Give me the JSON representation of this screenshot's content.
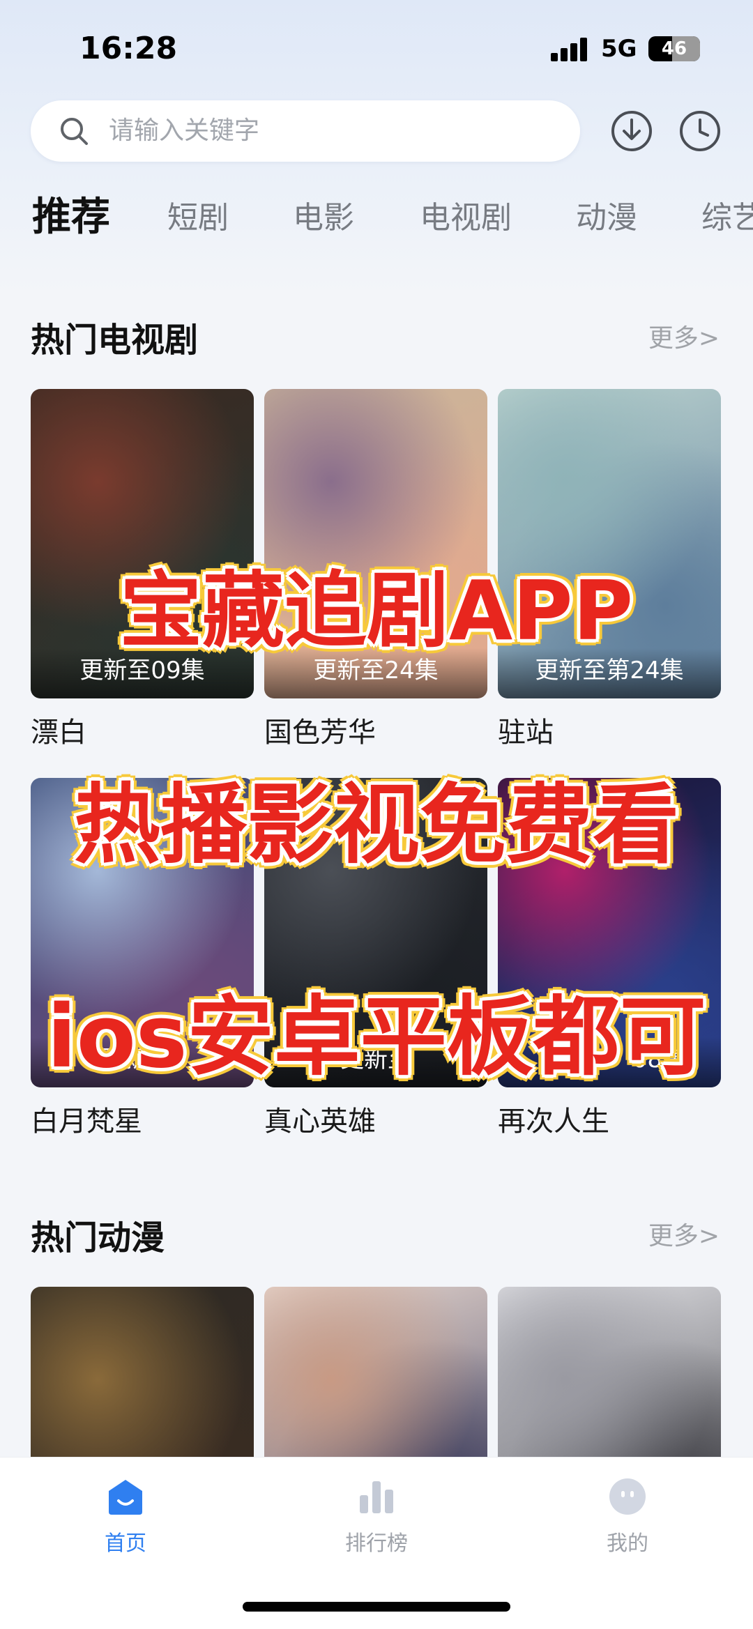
{
  "status_bar": {
    "time": "16:28",
    "network": "5G",
    "battery": "46",
    "battery_level": 0.46
  },
  "search": {
    "placeholder": "请输入关键字",
    "icon": "search-icon"
  },
  "header_icons": [
    "download-icon",
    "history-clock-icon"
  ],
  "tabs": [
    {
      "label": "推荐",
      "active": true
    },
    {
      "label": "短剧"
    },
    {
      "label": "电影"
    },
    {
      "label": "电视剧"
    },
    {
      "label": "动漫"
    },
    {
      "label": "综艺"
    }
  ],
  "sections": {
    "tv": {
      "title": "热门电视剧",
      "more": "更多>",
      "items": [
        {
          "title": "漂白",
          "badge": "更新至09集",
          "colors": [
            "#3a2a22",
            "#7a3b2e",
            "#2a3530"
          ]
        },
        {
          "title": "国色芳华",
          "badge": "更新至24集",
          "colors": [
            "#c9b49a",
            "#8a6e8c",
            "#e2a98e"
          ]
        },
        {
          "title": "驻站",
          "badge": "更新至第24集",
          "colors": [
            "#bcd3cf",
            "#8fb3b8",
            "#5e7e9c"
          ]
        },
        {
          "title": "白月梵星",
          "badge": "更新至2",
          "colors": [
            "#3a4c78",
            "#a4b8d8",
            "#6a4a7a"
          ]
        },
        {
          "title": "真心英雄",
          "badge": "更新至",
          "colors": [
            "#2a2d33",
            "#4b4f56",
            "#1c1f24"
          ]
        },
        {
          "title": "再次人生",
          "badge": "08集",
          "colors": [
            "#1a1436",
            "#b0206a",
            "#2a3f8a"
          ]
        }
      ]
    },
    "anime": {
      "title": "热门动漫",
      "more": "更多>",
      "items": [
        {
          "colors": [
            "#2e2a24",
            "#8a6a3a",
            "#3a2c22"
          ]
        },
        {
          "colors": [
            "#e8d8d0",
            "#c89a84",
            "#3a3a5a"
          ]
        },
        {
          "colors": [
            "#e4e4e8",
            "#9a9aa2",
            "#3a3a40"
          ]
        }
      ]
    }
  },
  "promo": {
    "line1": "宝藏追剧APP",
    "line2": "热播影视免费看",
    "line3": "ios安卓平板都可"
  },
  "bottom_nav": [
    {
      "label": "首页",
      "icon": "home-icon",
      "active": true
    },
    {
      "label": "排行榜",
      "icon": "ranking-icon"
    },
    {
      "label": "我的",
      "icon": "profile-icon"
    }
  ],
  "colors": {
    "accent": "#2f7ff0",
    "promo_red": "#e8261e",
    "promo_outline": "#f7c93a"
  }
}
